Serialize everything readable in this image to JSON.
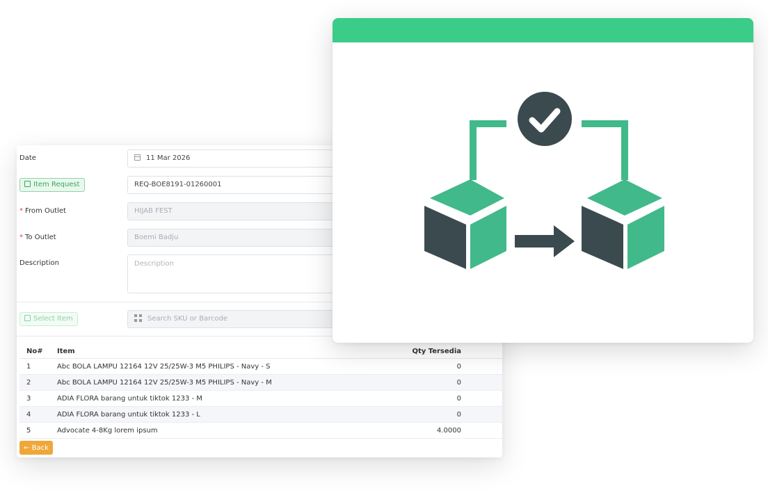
{
  "form": {
    "date_label": "Date",
    "date_value": "11 Mar 2026",
    "item_request_label": "Item Request",
    "item_request_value": "REQ-BOE8191-01260001",
    "from_outlet_label": "From Outlet",
    "from_outlet_value": "HIJAB FEST",
    "to_outlet_label": "To Outlet",
    "to_outlet_value": "Boemi Badju",
    "description_label": "Description",
    "description_placeholder": "Description",
    "select_item_label": "Select Item",
    "search_placeholder": "Search SKU or Barcode",
    "required_mark": "*"
  },
  "table": {
    "headers": {
      "no": "No#",
      "item": "Item",
      "qty": "Qty Tersedia"
    },
    "rows": [
      {
        "no": "1",
        "item": "Abc BOLA LAMPU 12164 12V 25/25W-3 M5 PHILIPS - Navy - S",
        "qty": "0"
      },
      {
        "no": "2",
        "item": "Abc BOLA LAMPU 12164 12V 25/25W-3 M5 PHILIPS - Navy - M",
        "qty": "0"
      },
      {
        "no": "3",
        "item": "ADIA FLORA barang untuk tiktok 1233 - M",
        "qty": "0"
      },
      {
        "no": "4",
        "item": "ADIA FLORA barang untuk tiktok 1233 - L",
        "qty": "0"
      },
      {
        "no": "5",
        "item": "Advocate 4-8Kg lorem ipsum",
        "qty": "4.0000"
      }
    ]
  },
  "back_label": "← Back",
  "icons": {
    "date": "calendar-icon",
    "item_request": "edit-icon",
    "select_item": "list-icon",
    "search": "qr-code-icon",
    "illustration": "stock-transfer-icon"
  },
  "colors": {
    "accent_green": "#3acc88",
    "illustration_dark": "#3b4a4f",
    "illustration_green": "#41b98a",
    "back_button": "#efa73a",
    "success_text": "#3aa55d"
  }
}
